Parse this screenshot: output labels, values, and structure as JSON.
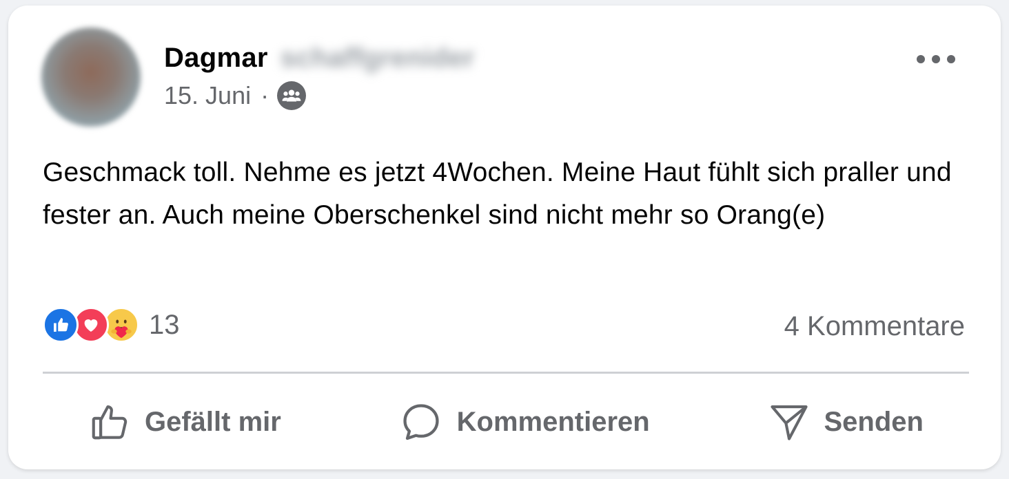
{
  "post": {
    "author_first": "Dagmar",
    "author_last": "schaffgrenider",
    "date": "15. Juni",
    "separator": "·",
    "audience_icon": "group-icon",
    "more_icon": "more-horizontal-icon",
    "text": "Geschmack toll. Nehme es jetzt 4Wochen. Meine Haut fühlt sich praller und fester an. Auch meine Oberschenkel sind nicht mehr so Orang(e)",
    "reactions": {
      "icons": [
        "like-reaction-icon",
        "love-reaction-icon",
        "care-reaction-icon"
      ],
      "count": "13"
    },
    "comments_label": "4 Kommentare"
  },
  "actions": {
    "like_label": "Gefällt mir",
    "comment_label": "Kommentieren",
    "send_label": "Senden"
  },
  "colors": {
    "text_primary": "#050505",
    "text_secondary": "#65676b",
    "like_blue": "#1b74e4",
    "love_red": "#f33e58",
    "care_yellow": "#f7c94a",
    "divider": "#ced0d4"
  }
}
